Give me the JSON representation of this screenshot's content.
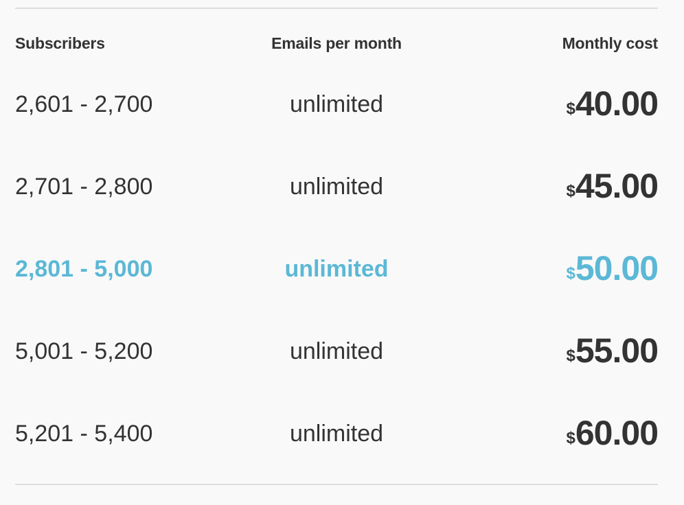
{
  "headers": {
    "subscribers": "Subscribers",
    "emails": "Emails per month",
    "cost": "Monthly cost"
  },
  "currency_symbol": "$",
  "accent_color": "#5bb8d6",
  "text_color": "#333333",
  "tiers": [
    {
      "subscribers": "2,601 - 2,700",
      "emails": "unlimited",
      "cost": "40.00",
      "highlighted": false
    },
    {
      "subscribers": "2,701 - 2,800",
      "emails": "unlimited",
      "cost": "45.00",
      "highlighted": false
    },
    {
      "subscribers": "2,801 - 5,000",
      "emails": "unlimited",
      "cost": "50.00",
      "highlighted": true
    },
    {
      "subscribers": "5,001 - 5,200",
      "emails": "unlimited",
      "cost": "55.00",
      "highlighted": false
    },
    {
      "subscribers": "5,201 - 5,400",
      "emails": "unlimited",
      "cost": "60.00",
      "highlighted": false
    }
  ]
}
